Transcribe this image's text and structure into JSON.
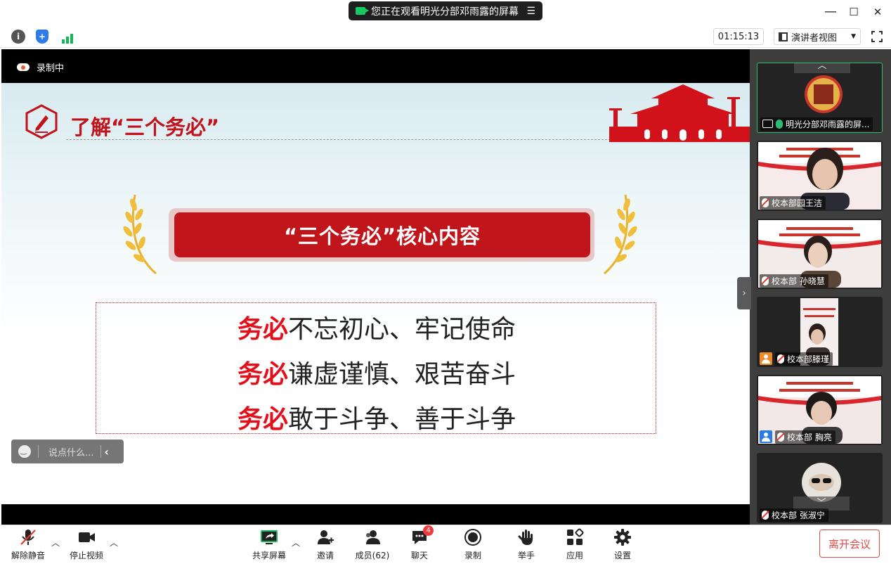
{
  "titlebar": {
    "share_notice": "您正在观看明光分部邓雨露的屏幕",
    "menu_icon": "list-icon",
    "minimize": "—",
    "maximize": "☐",
    "close": "✕"
  },
  "toolbar": {
    "info_icon": "i",
    "shield_icon": "+",
    "timer": "01:15:13",
    "view_mode": "演讲者视图"
  },
  "stage": {
    "recording_label": "录制中",
    "slide": {
      "title": "了解“三个务必”",
      "banner": "“三个务必”核心内容",
      "lines": [
        {
          "highlight": "务必",
          "text": "不忘初心、牢记使命"
        },
        {
          "highlight": "务必",
          "text": "谦虚谨慎、艰苦奋斗"
        },
        {
          "highlight": "务必",
          "text": "敢于斗争、善于斗争"
        }
      ]
    },
    "chat_placeholder": "说点什么...",
    "chat_collapse": "‹"
  },
  "participants": [
    {
      "name": "明光分部邓雨露的屏...",
      "mic": "on",
      "kind": "screen-share",
      "active": true
    },
    {
      "name": "校本部园王洁",
      "mic": "off",
      "kind": "camera",
      "active": false
    },
    {
      "name": "校本部 孙晓慧",
      "mic": "off",
      "kind": "camera",
      "active": false
    },
    {
      "name": "校本部滕瑾",
      "mic": "off",
      "kind": "camera",
      "active": false
    },
    {
      "name": "校本部 胸亮",
      "mic": "off",
      "kind": "camera",
      "active": false
    },
    {
      "name": "校本部 张淑宁",
      "mic": "off",
      "kind": "camera",
      "active": false
    }
  ],
  "panel_handle": "›",
  "bottombar": {
    "unmute": "解除静音",
    "stop_video": "停止视频",
    "share_screen": "共享屏幕",
    "invite": "邀请",
    "members": "成员(62)",
    "chat": "聊天",
    "chat_badge": "4",
    "record": "录制",
    "raise_hand": "举手",
    "apps": "应用",
    "settings": "设置",
    "leave": "离开会议"
  },
  "colors": {
    "accent_red": "#c1151c",
    "active_green": "#2cbd74",
    "leave_red": "#e04a4a"
  }
}
